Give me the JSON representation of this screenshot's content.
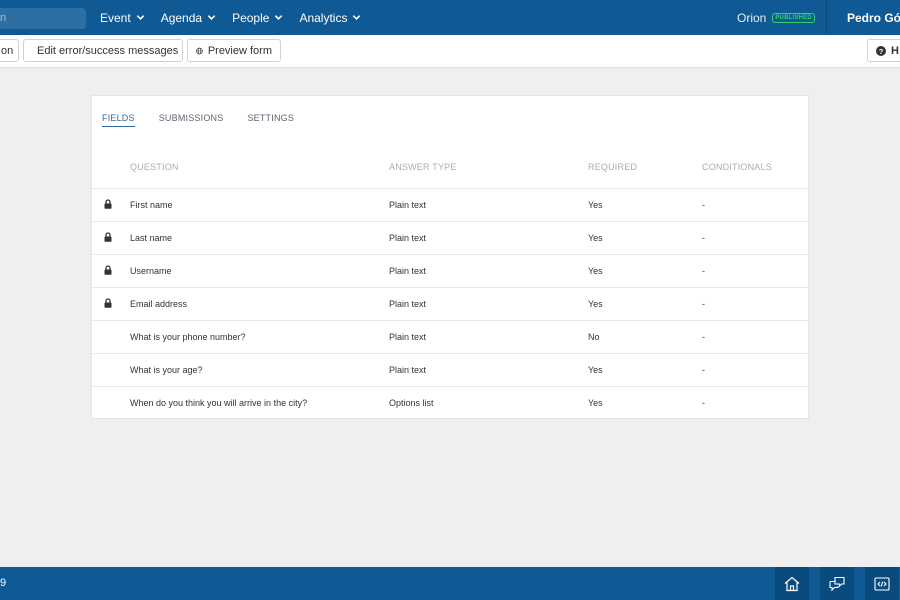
{
  "header": {
    "search_fragment": "n",
    "nav": [
      {
        "label": "Event"
      },
      {
        "label": "Agenda"
      },
      {
        "label": "People"
      },
      {
        "label": "Analytics"
      }
    ],
    "event_name": "Orion",
    "event_status": "PUBLISHED",
    "user_name": "Pedro Góes"
  },
  "toolbar": {
    "partial_button": "on",
    "edit_messages": "Edit error/success messages",
    "preview_form": "Preview form",
    "help_fragment": "H"
  },
  "tabs": [
    {
      "label": "FIELDS",
      "active": true
    },
    {
      "label": "SUBMISSIONS",
      "active": false
    },
    {
      "label": "SETTINGS",
      "active": false
    }
  ],
  "table": {
    "headers": {
      "question": "QUESTION",
      "answer_type": "ANSWER TYPE",
      "required": "REQUIRED",
      "conditionals": "CONDITIONALS"
    },
    "rows": [
      {
        "locked": true,
        "question": "First name",
        "answer_type": "Plain text",
        "required": "Yes",
        "conditionals": "-"
      },
      {
        "locked": true,
        "question": "Last name",
        "answer_type": "Plain text",
        "required": "Yes",
        "conditionals": "-"
      },
      {
        "locked": true,
        "question": "Username",
        "answer_type": "Plain text",
        "required": "Yes",
        "conditionals": "-"
      },
      {
        "locked": true,
        "question": "Email address",
        "answer_type": "Plain text",
        "required": "Yes",
        "conditionals": "-"
      },
      {
        "locked": false,
        "question": "What is your phone number?",
        "answer_type": "Plain text",
        "required": "No",
        "conditionals": "-"
      },
      {
        "locked": false,
        "question": "What is your age?",
        "answer_type": "Plain text",
        "required": "Yes",
        "conditionals": "-"
      },
      {
        "locked": false,
        "question": "When do you think you will arrive in the city?",
        "answer_type": "Options list",
        "required": "Yes",
        "conditionals": "-"
      }
    ]
  },
  "footer": {
    "left_fragment": "9",
    "icons": [
      "home-icon",
      "chat-icon",
      "code-icon"
    ]
  },
  "colors": {
    "brand": "#0f5a94",
    "accent": "#2f6b9d",
    "published": "#2fd36a"
  }
}
